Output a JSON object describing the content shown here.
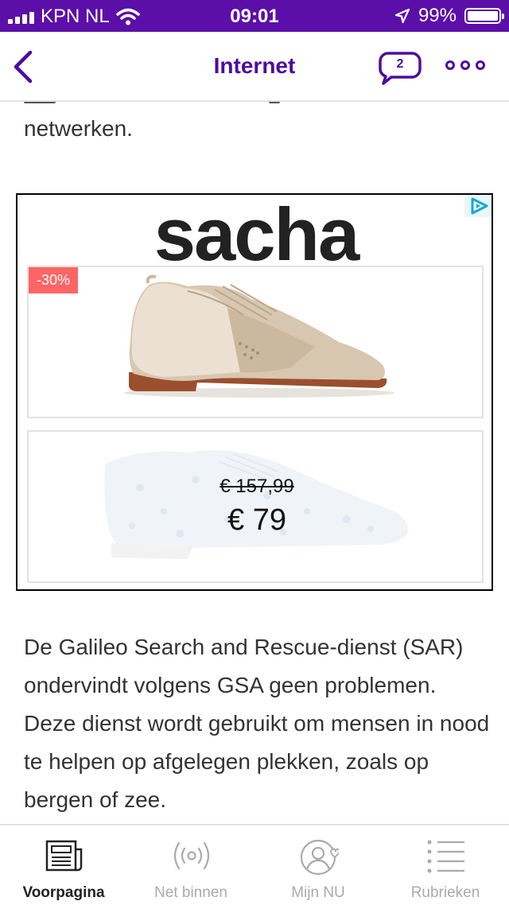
{
  "status_bar": {
    "carrier": "KPN NL",
    "time": "09:01",
    "battery": "99%"
  },
  "nav": {
    "title": "Internet",
    "comment_count": "2",
    "icons": [
      "chevron-left-icon",
      "comment-bubble-icon",
      "more-dots-icon"
    ]
  },
  "article": {
    "para_before": "netwerken.",
    "para_after": "De Galileo Search and Rescue-dienst (SAR) ondervindt volgens GSA geen problemen. Deze dienst wordt gebruikt om mensen in nood te helpen op afgelegen plekken, zoals op bergen of zee."
  },
  "ad": {
    "brand": "sacha",
    "discount": "-30%",
    "price_old": "€ 157,99",
    "price_new": "€ 79"
  },
  "tabbar": {
    "items": [
      {
        "label": "Voorpagina",
        "icon": "newspaper-icon",
        "active": true
      },
      {
        "label": "Net binnen",
        "icon": "broadcast-icon",
        "active": false
      },
      {
        "label": "Mijn NU",
        "icon": "profile-heart-icon",
        "active": false
      },
      {
        "label": "Rubrieken",
        "icon": "list-icon",
        "active": false
      }
    ]
  },
  "colors": {
    "brand_purple": "#5b0fa8",
    "accent_purple": "#4b0d9e",
    "discount_red": "#ff6565"
  }
}
